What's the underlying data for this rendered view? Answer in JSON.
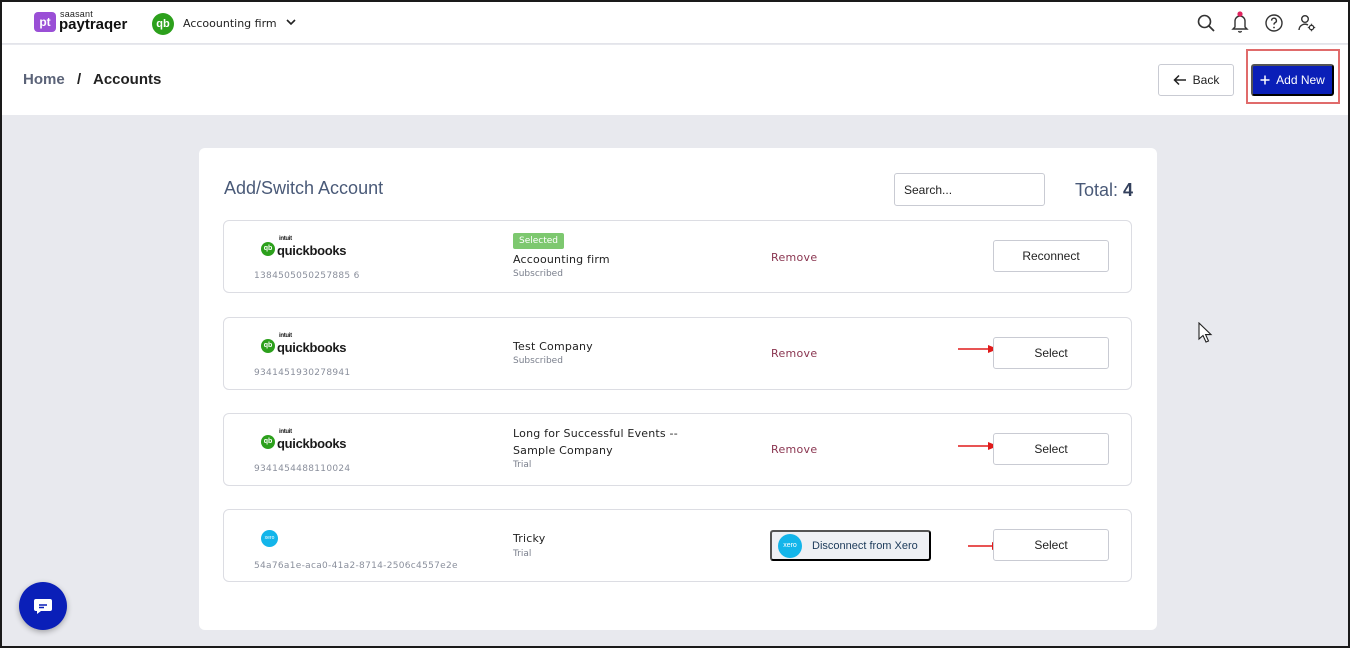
{
  "brand": {
    "badge": "pt",
    "small": "saasant",
    "name": "paytraqer"
  },
  "company": {
    "badge": "qb",
    "name": "Accoounting firm"
  },
  "icons": {
    "search": "search-icon",
    "bell": "bell-icon",
    "help": "help-icon",
    "user_settings": "user-settings-icon",
    "back": "arrow-left-icon",
    "add": "plus-icon",
    "chat": "chat-icon",
    "cursor": "mouse-cursor-icon"
  },
  "colors": {
    "primary": "#0a1fb8",
    "selected_badge": "#7dc86f",
    "remove": "#8a3550",
    "notification_dot": "#e0245e",
    "quickbooks": "#2ca01c",
    "xero": "#13b5ea"
  },
  "breadcrumb": {
    "home": "Home",
    "separator": "/",
    "current": "Accounts"
  },
  "header": {
    "back_label": "Back",
    "add_new_label": "Add New"
  },
  "card": {
    "title": "Add/Switch Account",
    "search_placeholder": "Search...",
    "total_label": "Total:",
    "total_value": "4"
  },
  "accounts": [
    {
      "provider": "quickbooks",
      "logo_small": "intuit",
      "logo_text": "quickbooks",
      "realm_id": "1384505050257885 6",
      "badge": "Selected",
      "name": "Accoounting firm",
      "status": "Subscribed",
      "remove_label": "Remove",
      "action_label": "Reconnect"
    },
    {
      "provider": "quickbooks",
      "logo_small": "intuit",
      "logo_text": "quickbooks",
      "realm_id": "9341451930278941",
      "name": "Test Company",
      "status": "Subscribed",
      "remove_label": "Remove",
      "action_label": "Select"
    },
    {
      "provider": "quickbooks",
      "logo_small": "intuit",
      "logo_text": "quickbooks",
      "realm_id": "9341454488110024",
      "name": "Long for Successful Events -- Sample Company",
      "status": "Trial",
      "remove_label": "Remove",
      "action_label": "Select"
    },
    {
      "provider": "xero",
      "logo_text": "xero",
      "realm_id": "54a76a1e-aca0-41a2-8714-2506c4557e2e",
      "name": "Tricky",
      "status": "Trial",
      "disconnect_label": "Disconnect from Xero",
      "action_label": "Select"
    }
  ]
}
